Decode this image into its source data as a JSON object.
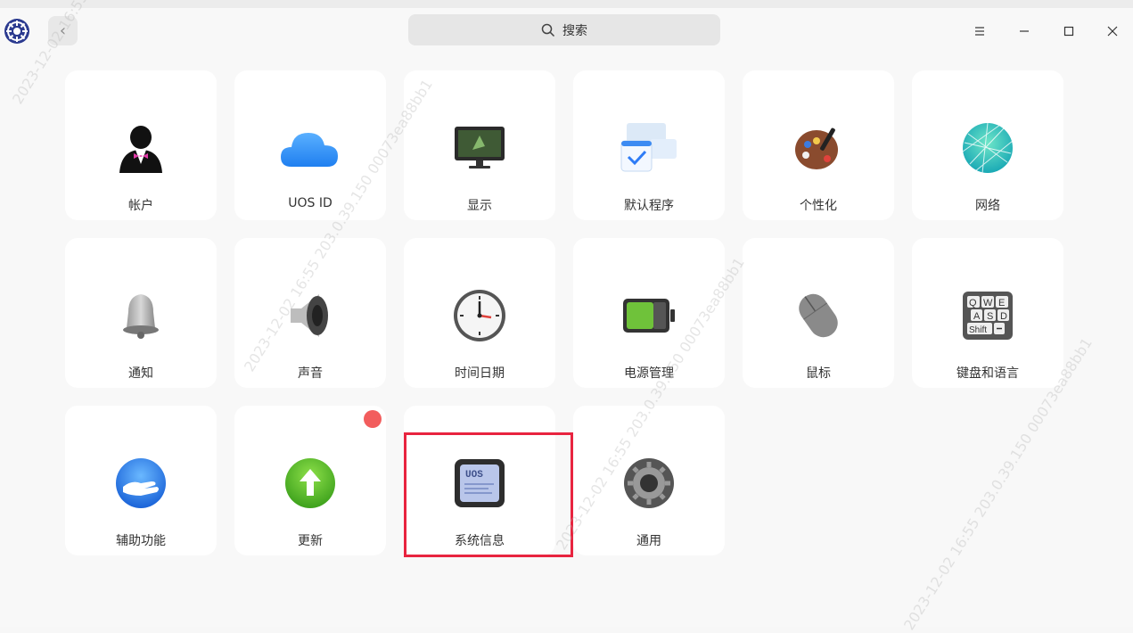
{
  "search": {
    "placeholder": "搜索"
  },
  "tiles": [
    {
      "label": "帐户",
      "icon": "account-icon"
    },
    {
      "label": "UOS ID",
      "icon": "cloud-icon"
    },
    {
      "label": "显示",
      "icon": "display-icon"
    },
    {
      "label": "默认程序",
      "icon": "default-apps-icon"
    },
    {
      "label": "个性化",
      "icon": "palette-icon"
    },
    {
      "label": "网络",
      "icon": "network-globe-icon"
    },
    {
      "label": "通知",
      "icon": "bell-icon"
    },
    {
      "label": "声音",
      "icon": "speaker-icon"
    },
    {
      "label": "时间日期",
      "icon": "clock-icon"
    },
    {
      "label": "电源管理",
      "icon": "battery-icon"
    },
    {
      "label": "鼠标",
      "icon": "mouse-icon"
    },
    {
      "label": "键盘和语言",
      "icon": "keyboard-icon"
    },
    {
      "label": "辅助功能",
      "icon": "accessibility-hand-icon"
    },
    {
      "label": "更新",
      "icon": "update-arrow-icon"
    },
    {
      "label": "系统信息",
      "icon": "system-info-icon"
    },
    {
      "label": "通用",
      "icon": "gear-icon"
    }
  ],
  "system_info_icon_text": "UOS",
  "keyboard_keys": [
    "Q",
    "W",
    "E",
    "A",
    "S",
    "D",
    "Shift"
  ],
  "watermark_text": "2023-12-02 16:55 203.0.39.150 00073ea88bb1",
  "colors": {
    "highlight": "#e8243f",
    "badge": "#f25d5d",
    "accent": "#2f7cf6"
  }
}
